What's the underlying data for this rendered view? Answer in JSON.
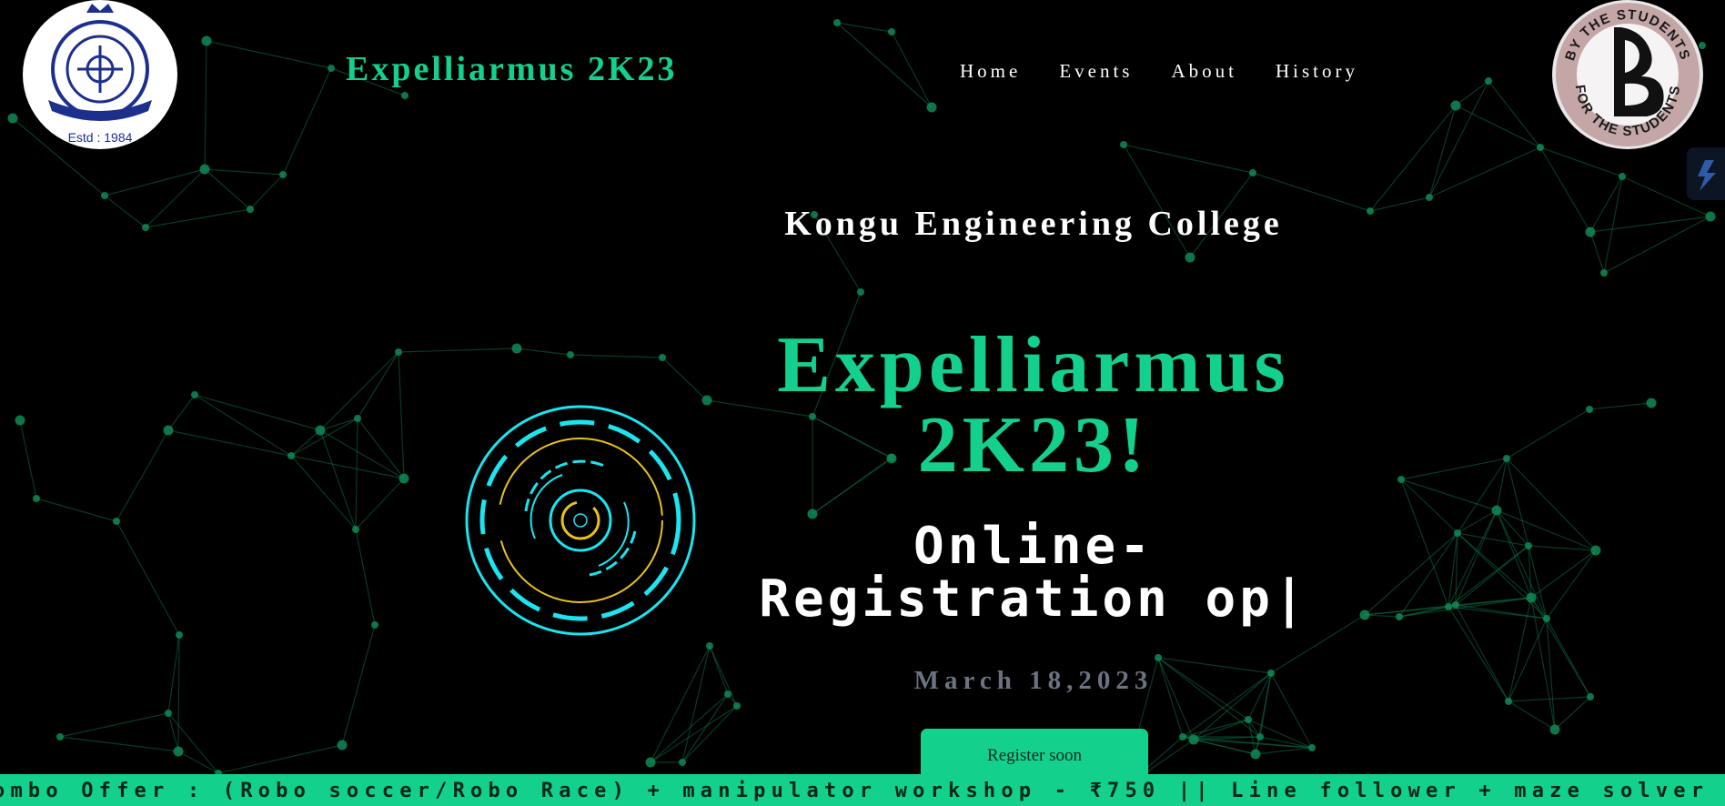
{
  "header": {
    "brand": "Expelliarmus 2K23",
    "nav": [
      "Home",
      "Events",
      "About",
      "History"
    ],
    "left_logo": {
      "icon": "college-crest-logo-icon",
      "caption": "Estd : 1984"
    },
    "right_logo": {
      "icon": "by-the-students-logo-icon",
      "text_top": "BY THE STUDENTS",
      "text_bottom": "FOR THE STUDENTS"
    }
  },
  "hero": {
    "college": "Kongu Engineering College",
    "title_line1": "Expelliarmus",
    "title_line2": "2K23!",
    "typed_line1": "Online-",
    "typed_line2": "Registration op",
    "date": "March 18,2023",
    "register_label": "Register soon"
  },
  "ticker": {
    "text": "ombo Offer : (Robo soccer/Robo Race) + manipulator workshop - ₹750 || Line follower + maze solver + manipulato"
  },
  "colors": {
    "accent": "#13d18d",
    "background": "#000000",
    "network": "#0f8a57",
    "radar_cyan": "#19e6f0",
    "radar_yellow": "#e8c21a"
  }
}
